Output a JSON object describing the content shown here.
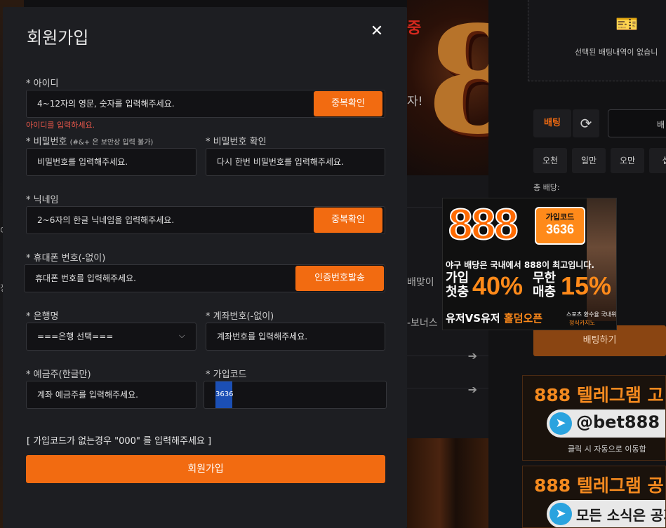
{
  "modal": {
    "title": "회원가입",
    "close_icon": "close-icon"
  },
  "form": {
    "id_label": "* 아이디",
    "id_placeholder": "4~12자의 영문, 숫자를 입력해주세요.",
    "id_check_button": "중복확인",
    "id_error": "아이디를 입력하세요.",
    "pw_label": "* 비밀번호",
    "pw_hint": "(#&+ 은 보안상 입력 불가)",
    "pw_placeholder": "비밀번호를 입력해주세요.",
    "pw_confirm_label": "* 비밀번호 확인",
    "pw_confirm_placeholder": "다시 한번 비밀번호를 입력해주세요.",
    "nick_label": "* 닉네임",
    "nick_placeholder": "2~6자의 한글 닉네임을 입력해주세요.",
    "nick_check_button": "중복확인",
    "phone_label": "* 휴대폰 번호(-없이)",
    "phone_placeholder": "휴대폰 번호를 입력해주세요.",
    "phone_verify_button": "인증번호발송",
    "bank_label": "* 은행명",
    "bank_selected": "===은행 선택===",
    "account_label": "* 계좌번호(-없이)",
    "account_placeholder": "계좌번호를 입력해주세요.",
    "holder_label": "* 예금주(한글만)",
    "holder_placeholder": "계좌 예금주를 입력해주세요.",
    "code_label": "* 가입코드",
    "code_value": "3636",
    "note": "[ 가입코드가 없는경우 \"000\" 를 입력해주세요 ]",
    "submit_button": "회원가입"
  },
  "background": {
    "hero_red_text": "중",
    "hero_text": "자!",
    "hero_digit": "8",
    "side_text_1": "배맞이",
    "side_text_2": "-보너스",
    "left_text_1": "이",
    "left_text_2": "정",
    "betslip": {
      "empty_message": "선택된 배팅내역이 없습니",
      "tab_label": "배팅",
      "input_partial": "배",
      "amounts": [
        "오천",
        "일만",
        "오만",
        "십"
      ],
      "total_label": "총 배당:",
      "bet_button": "배팅하기"
    },
    "telegram": [
      {
        "title": "888 텔레그램 고",
        "handle": "@bet888",
        "sub": "클릭 시 자동으로 이동합"
      },
      {
        "title": "888 텔레그램 공",
        "handle": "모든 소식은 공지"
      }
    ]
  },
  "promo": {
    "brand": "888",
    "code_label": "가입코드",
    "code": "3636",
    "line1": "야구 배당은 국내에서 888이 최고입니다.",
    "first_label": "가입\n첫충",
    "first_pct": "40%",
    "unlimited_label": "무한\n매충",
    "unlimited_pct": "15%",
    "line3a": "유저VS유저",
    "line3b": "홀덤오픈",
    "line3c": "스포츠 환수율 국내위",
    "line3d": "정식카지노",
    "colors": {
      "accent": "#f26b11",
      "promo_orange": "#ff8a1a"
    }
  }
}
